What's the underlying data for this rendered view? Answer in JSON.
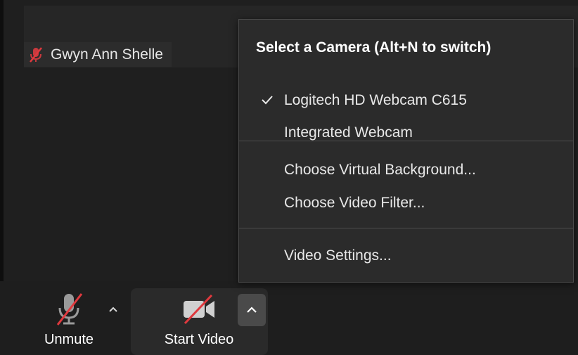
{
  "participant": {
    "name": "Gwyn Ann Shelle",
    "muted_icon": "mic-muted-icon"
  },
  "camera_menu": {
    "title": "Select a Camera (Alt+N to switch)",
    "cameras": [
      {
        "label": "Logitech HD Webcam C615",
        "selected": true
      },
      {
        "label": "Integrated Webcam",
        "selected": false
      }
    ],
    "background_items": [
      {
        "label": "Choose Virtual Background..."
      },
      {
        "label": "Choose Video Filter..."
      }
    ],
    "settings_items": [
      {
        "label": "Video Settings..."
      }
    ]
  },
  "toolbar": {
    "unmute_label": "Unmute",
    "unmute_icon": "mic-muted-icon",
    "start_video_label": "Start Video",
    "start_video_icon": "video-off-icon",
    "caret_icon": "chevron-up-icon"
  },
  "colors": {
    "background": "#1f1f1f",
    "menu_background": "#2b2b2b",
    "muted_red": "#e0393e",
    "text": "#ffffff"
  }
}
